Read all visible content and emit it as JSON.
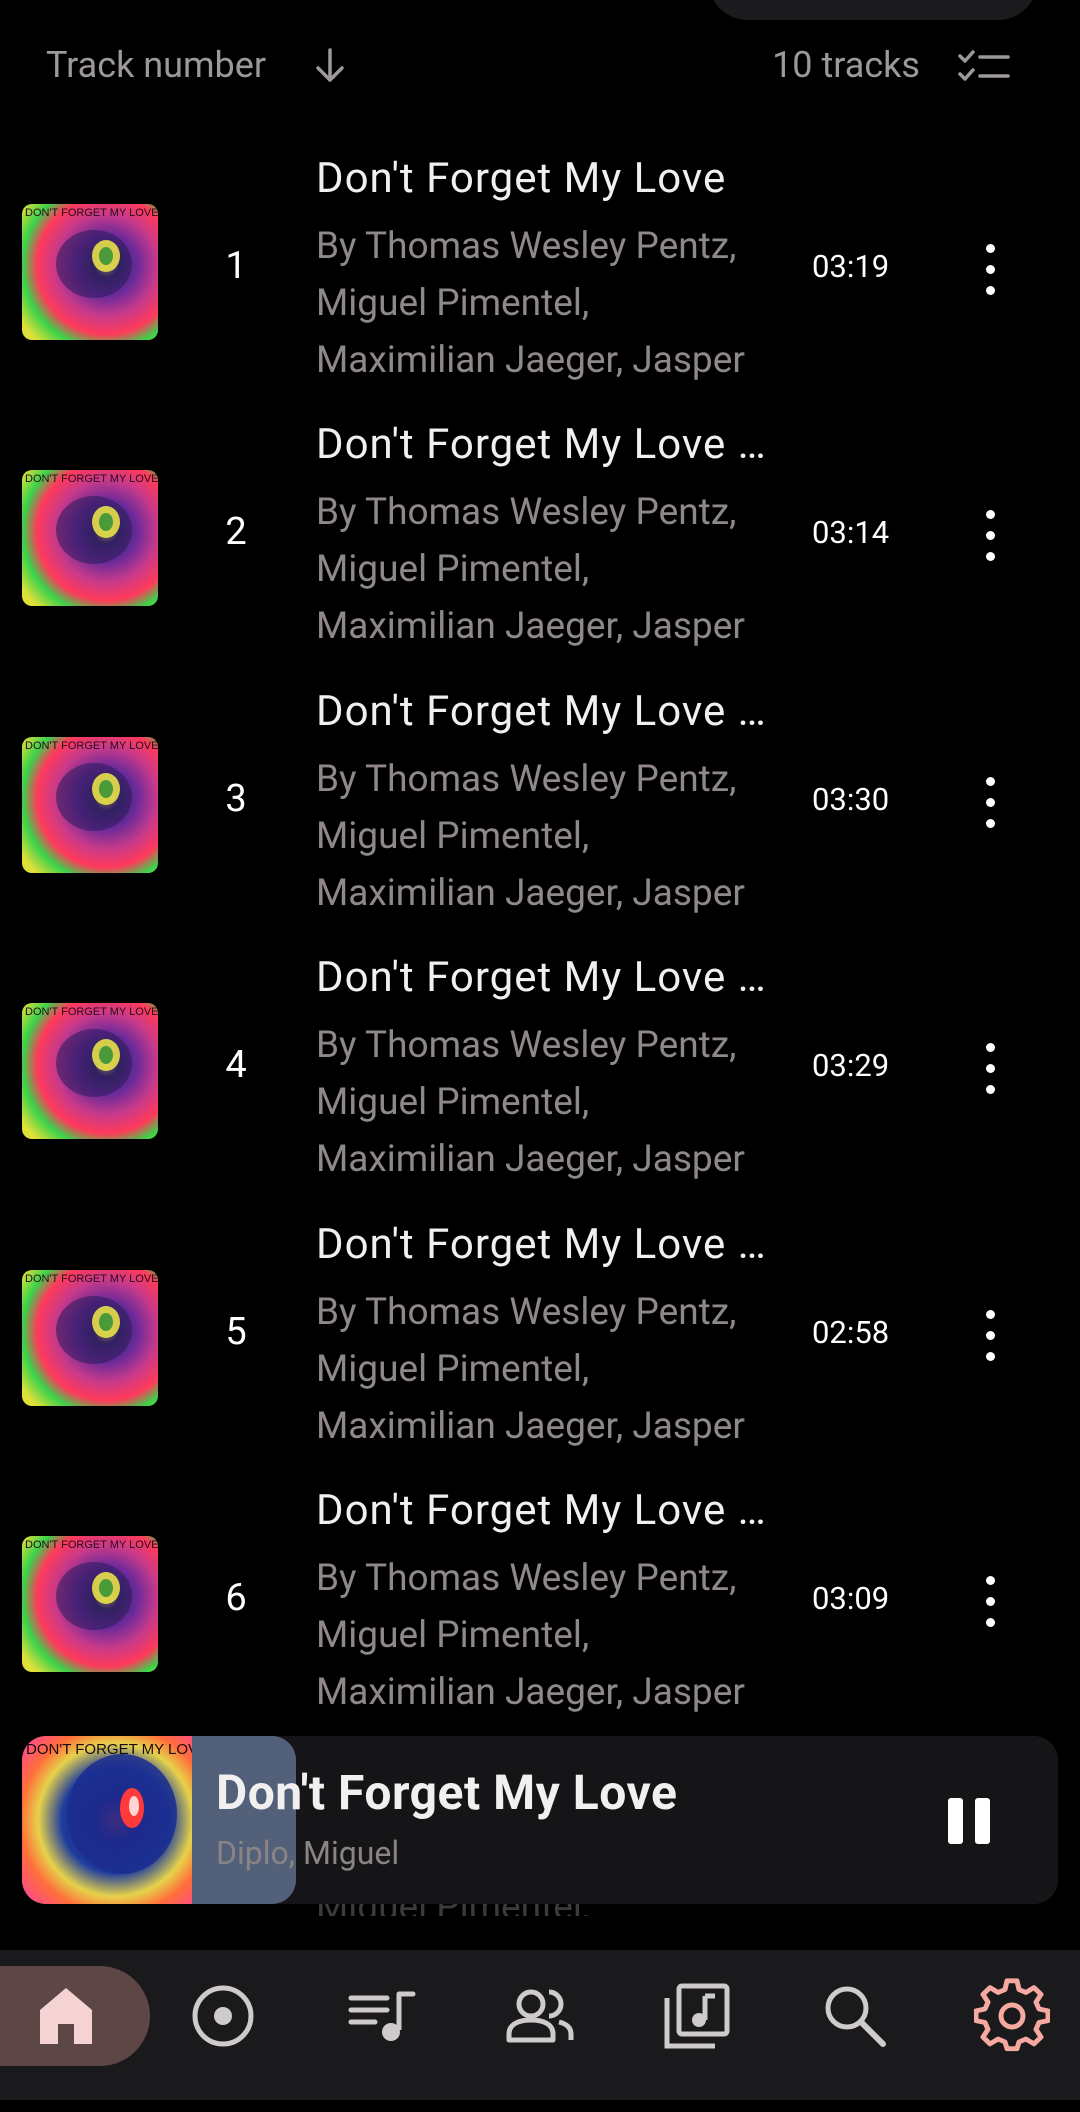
{
  "sort_bar": {
    "sort_label": "Track number",
    "track_count": "10 tracks"
  },
  "tracks": [
    {
      "number": "1",
      "title": "Don't Forget My Love",
      "artist": "By Thomas Wesley Pentz, Miguel Pimentel, Maximilian Jaeger, Jasper",
      "duration": "03:19",
      "art_text": "DON'T FORGET MY LOVE"
    },
    {
      "number": "2",
      "title": "Don't Forget My Love (Extended)",
      "artist": "By Thomas Wesley Pentz, Miguel Pimentel, Maximilian Jaeger, Jasper",
      "duration": "03:14",
      "art_text": "DON'T FORGET MY LOVE"
    },
    {
      "number": "3",
      "title": "Don't Forget My Love (Remix)",
      "artist": "By Thomas Wesley Pentz, Miguel Pimentel, Maximilian Jaeger, Jasper",
      "duration": "03:30",
      "art_text": "DON'T FORGET MY LOVE"
    },
    {
      "number": "4",
      "title": "Don't Forget My Love (Remix)",
      "artist": "By Thomas Wesley Pentz, Miguel Pimentel, Maximilian Jaeger, Jasper",
      "duration": "03:29",
      "art_text": "DON'T FORGET MY LOVE"
    },
    {
      "number": "5",
      "title": "Don't Forget My Love (Remix)",
      "artist": "By Thomas Wesley Pentz, Miguel Pimentel, Maximilian Jaeger, Jasper",
      "duration": "02:58",
      "art_text": "DON'T FORGET MY LOVE"
    },
    {
      "number": "6",
      "title": "Don't Forget My Love (Remix)",
      "artist": "By Thomas Wesley Pentz, Miguel Pimentel, Maximilian Jaeger, Jasper",
      "duration": "03:09",
      "art_text": "DON'T FORGET MY LOVE"
    }
  ],
  "ghost_text": "Miguel Pimentel,",
  "mini_player": {
    "title": "Don't Forget My Love",
    "artist": "Diplo, Miguel",
    "art_text": "DON'T FORGET MY LOVE"
  },
  "nav": {
    "items": [
      "home-icon",
      "disc-icon",
      "queue-music-icon",
      "artists-icon",
      "library-music-icon",
      "search-icon",
      "settings-icon"
    ],
    "active": "home-icon",
    "active_color": "#f2bcbc",
    "accent_color": "#f6a9a0"
  }
}
